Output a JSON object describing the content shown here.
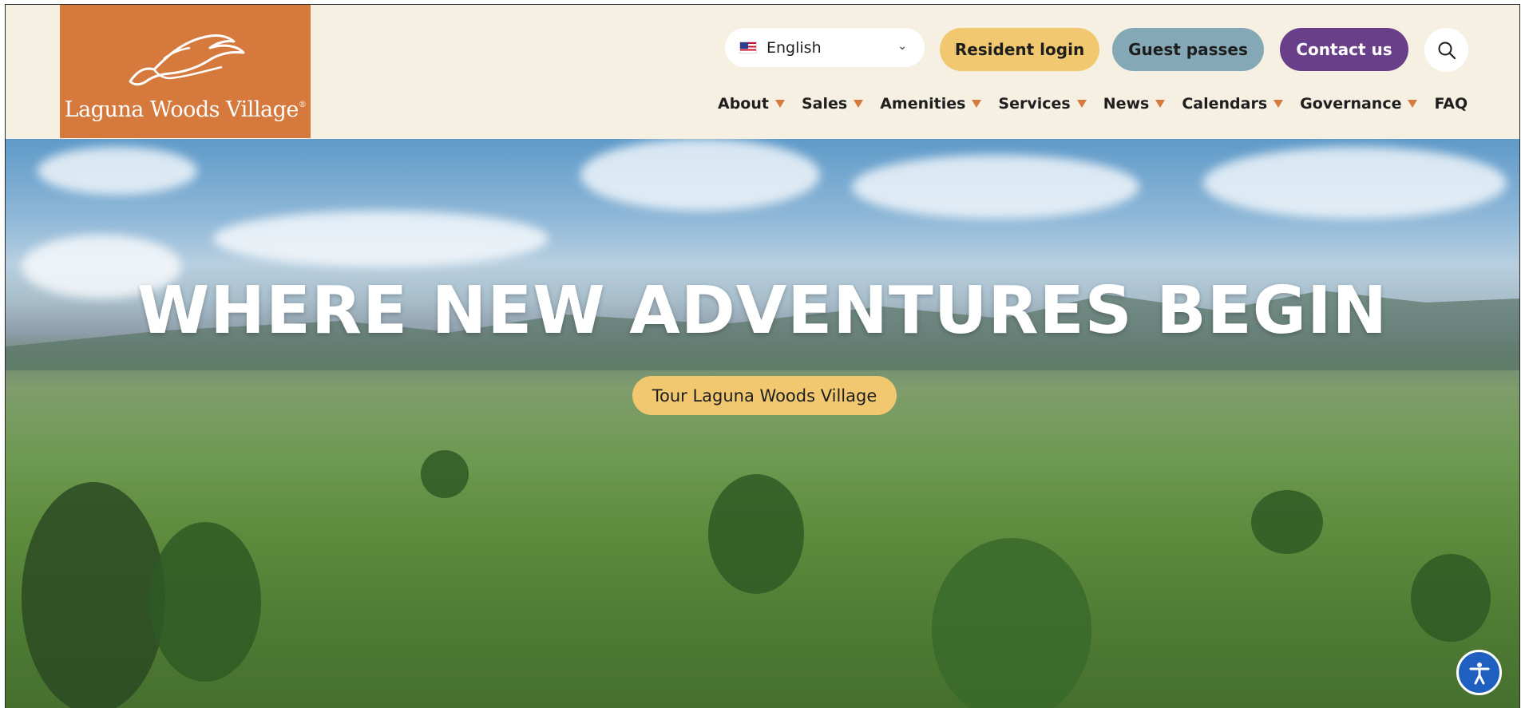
{
  "header": {
    "logo": {
      "text": "Laguna Woods Village",
      "mark": "®"
    },
    "language": {
      "selected": "English",
      "icon": "us-flag-icon"
    },
    "buttons": {
      "resident_login": "Resident login",
      "guest_passes": "Guest passes",
      "contact_us": "Contact us"
    },
    "search_icon": "search-icon",
    "nav": [
      {
        "label": "About",
        "has_menu": true
      },
      {
        "label": "Sales",
        "has_menu": true
      },
      {
        "label": "Amenities",
        "has_menu": true
      },
      {
        "label": "Services",
        "has_menu": true
      },
      {
        "label": "News",
        "has_menu": true
      },
      {
        "label": "Calendars",
        "has_menu": true
      },
      {
        "label": "Governance",
        "has_menu": true
      },
      {
        "label": "FAQ",
        "has_menu": false
      }
    ]
  },
  "hero": {
    "title": "WHERE NEW ADVENTURES BEGIN",
    "cta": "Tour Laguna Woods Village"
  },
  "accessibility": {
    "icon": "accessibility-icon"
  },
  "colors": {
    "background": "#f6f0e2",
    "logo_orange": "#d5793c",
    "resident_yellow": "#f1c86f",
    "guest_blue": "#84a8b6",
    "contact_purple": "#6a3f8a",
    "a11y_blue": "#1f5fbf"
  }
}
